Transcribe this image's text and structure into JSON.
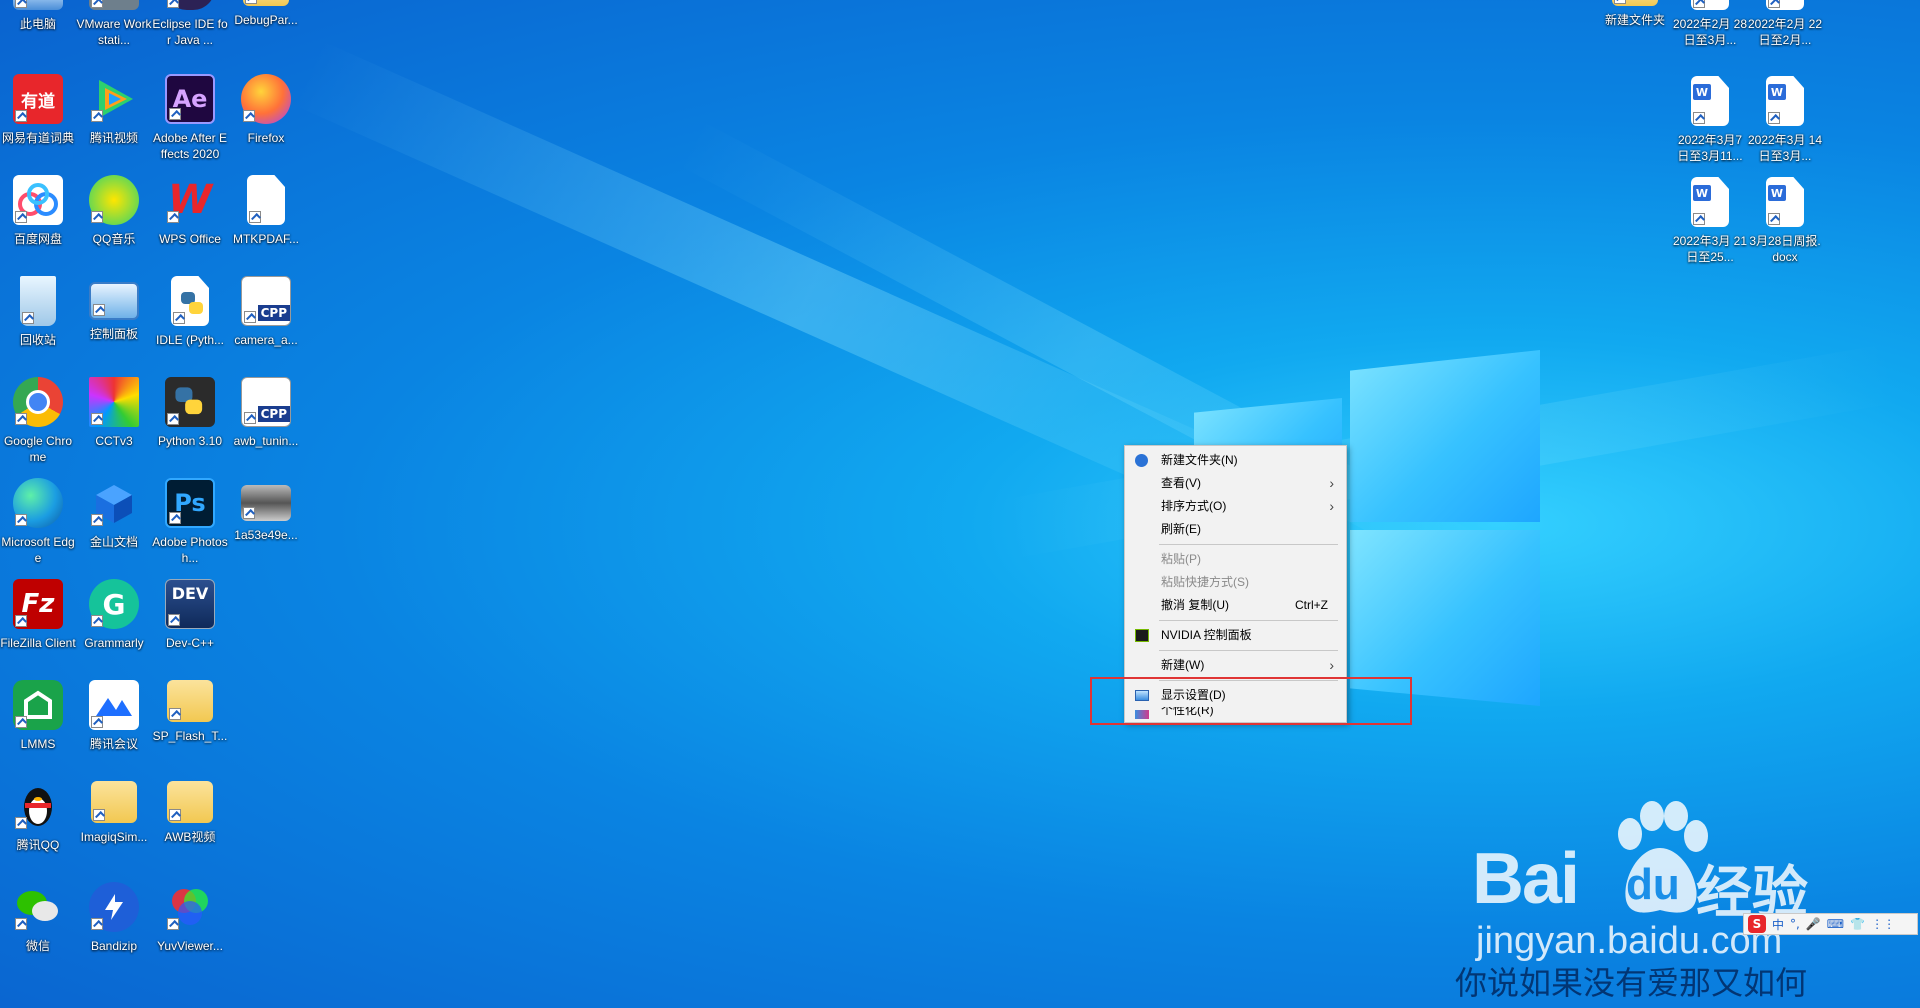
{
  "desktop_icons": [
    {
      "label": "此电脑"
    },
    {
      "label": "VMware Workstati..."
    },
    {
      "label": "Eclipse IDE for Java ..."
    },
    {
      "label": "DebugPar..."
    },
    {
      "label": "网易有道词典"
    },
    {
      "label": "腾讯视频"
    },
    {
      "label": "Adobe After Effects 2020"
    },
    {
      "label": "Firefox"
    },
    {
      "label": "百度网盘"
    },
    {
      "label": "QQ音乐"
    },
    {
      "label": "WPS Office"
    },
    {
      "label": "MTKPDAF..."
    },
    {
      "label": "回收站"
    },
    {
      "label": "控制面板"
    },
    {
      "label": "IDLE (Pyth..."
    },
    {
      "label": "camera_a..."
    },
    {
      "label": "Google Chrome"
    },
    {
      "label": "CCTv3"
    },
    {
      "label": "Python 3.10"
    },
    {
      "label": "awb_tunin..."
    },
    {
      "label": "Microsoft Edge"
    },
    {
      "label": "金山文档"
    },
    {
      "label": "Adobe Photosh..."
    },
    {
      "label": "1a53e49e..."
    },
    {
      "label": "FileZilla Client"
    },
    {
      "label": "Grammarly"
    },
    {
      "label": "Dev-C++"
    },
    {
      "label": "LMMS"
    },
    {
      "label": "腾讯会议"
    },
    {
      "label": "SP_Flash_T..."
    },
    {
      "label": "腾讯QQ"
    },
    {
      "label": "ImagiqSim..."
    },
    {
      "label": "AWB视频"
    },
    {
      "label": "微信"
    },
    {
      "label": "Bandizip"
    },
    {
      "label": "YuvViewer..."
    },
    {
      "label": "新建文件夹"
    },
    {
      "label": "2022年2月 28日至3月..."
    },
    {
      "label": "2022年2月 22日至2月..."
    },
    {
      "label": "2022年3月7 日至3月11..."
    },
    {
      "label": "2022年3月 14日至3月..."
    },
    {
      "label": "2022年3月 21日至25..."
    },
    {
      "label": "3月28日周报. docx"
    }
  ],
  "icon_glyphs": {
    "youdao": "有道",
    "ae": "Ae",
    "ps": "Ps",
    "dev": "DEV",
    "cpp": "CPP",
    "wps": "W",
    "grammarly": "G",
    "fz": "Fz"
  },
  "context_menu": {
    "items": [
      {
        "label": "新建文件夹(N)",
        "enabled": true
      },
      {
        "label": "查看(V)",
        "enabled": true,
        "submenu": true
      },
      {
        "label": "排序方式(O)",
        "enabled": true,
        "submenu": true
      },
      {
        "label": "刷新(E)",
        "enabled": true
      },
      {
        "label": "粘贴(P)",
        "enabled": false
      },
      {
        "label": "粘贴快捷方式(S)",
        "enabled": false
      },
      {
        "label": "撤消 复制(U)",
        "shortcut": "Ctrl+Z",
        "enabled": true
      },
      {
        "label": "NVIDIA 控制面板",
        "enabled": true
      },
      {
        "label": "新建(W)",
        "enabled": true,
        "submenu": true
      },
      {
        "label": "显示设置(D)",
        "enabled": true
      },
      {
        "label": "个性化(R)",
        "enabled": true
      }
    ],
    "submenu_glyph": "›"
  },
  "watermark": {
    "brand_text": "Bai",
    "paw_text": "du",
    "product": "经验",
    "url": "jingyan.baidu.com",
    "caption": "你说如果没有爱那又如何"
  },
  "ime_tray": {
    "logo": "S",
    "items": [
      "中",
      "°,",
      "🎤",
      "⌨",
      "👕",
      "⋮⋮"
    ]
  },
  "colors": {
    "highlight_box": "#e03535",
    "desktop_blue": "#0a84e2",
    "menu_bg": "#f2f2f2"
  }
}
